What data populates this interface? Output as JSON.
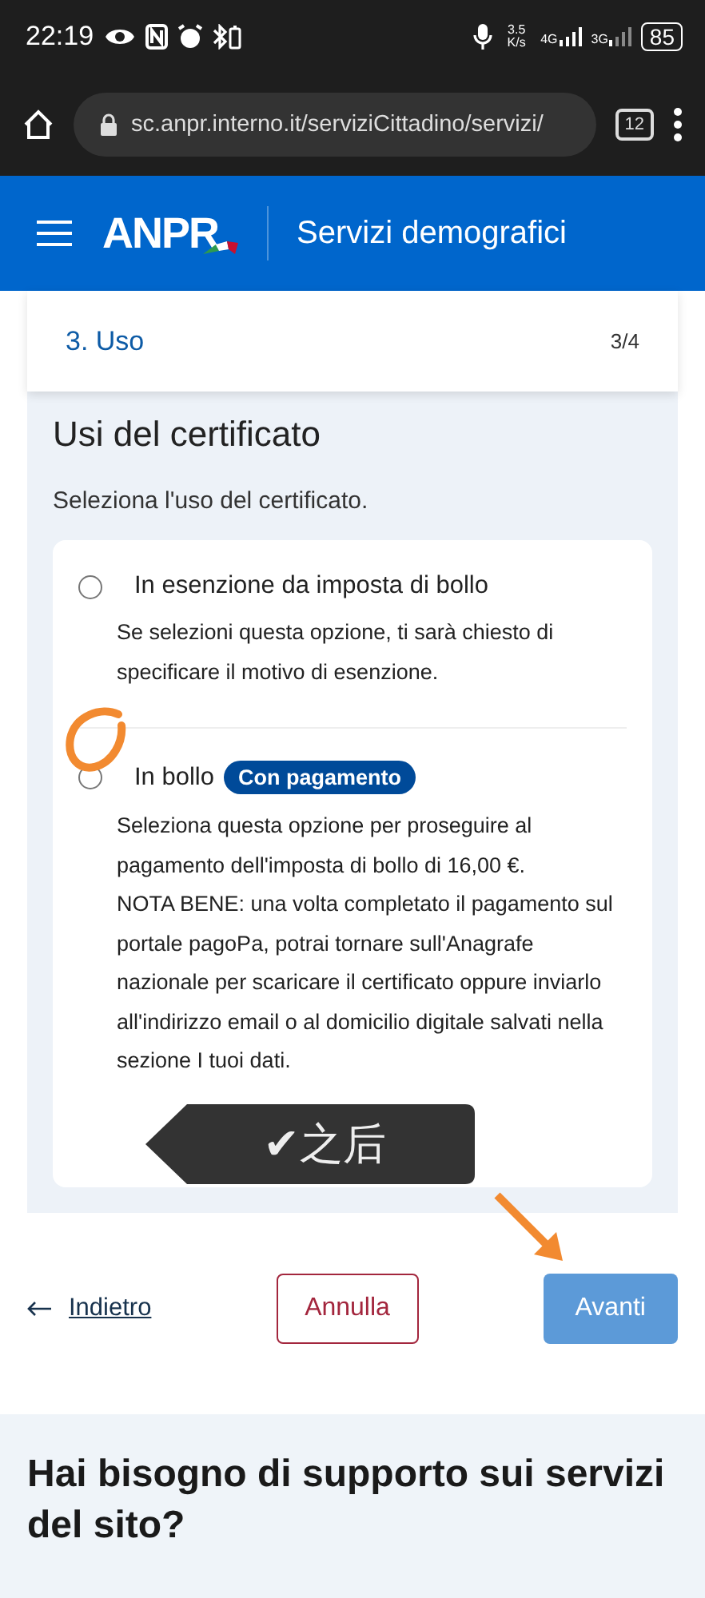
{
  "status_bar": {
    "time": "22:19",
    "network_speed": "3.5 K/s",
    "signal_1": "4G",
    "signal_2": "3G",
    "battery": "85"
  },
  "browser": {
    "url": "sc.anpr.interno.it/serviziCittadino/servizi/",
    "tab_count": "12"
  },
  "header": {
    "logo": "ANPR",
    "title": "Servizi demografici"
  },
  "stepper": {
    "step": "3. Uso",
    "progress": "3/4"
  },
  "section": {
    "title": "Usi del certificato",
    "subtitle": "Seleziona l'uso del certificato.",
    "options": [
      {
        "label": "In esenzione da imposta di bollo",
        "selected": false,
        "description": [
          "Se selezioni questa opzione, ti sarà chiesto di specificare il motivo di esenzione."
        ]
      },
      {
        "label": "In bollo",
        "badge": "Con pagamento",
        "selected": false,
        "description": [
          "Seleziona questa opzione per proseguire al pagamento dell'imposta di bollo di 16,00 €.",
          "NOTA BENE: una volta completato il pagamento sul portale pagoPa, potrai tornare sull'Anagrafe nazionale per scaricare il certificato oppure inviarlo all'indirizzo email o al domicilio digitale salvati nella sezione I tuoi dati."
        ]
      }
    ]
  },
  "actions": {
    "back": "Indietro",
    "cancel": "Annulla",
    "next": "Avanti",
    "next_disabled": true
  },
  "support": {
    "title": "Hai bisogno di supporto sui servizi del sito?"
  },
  "annotation": {
    "callout": "✔之后"
  }
}
